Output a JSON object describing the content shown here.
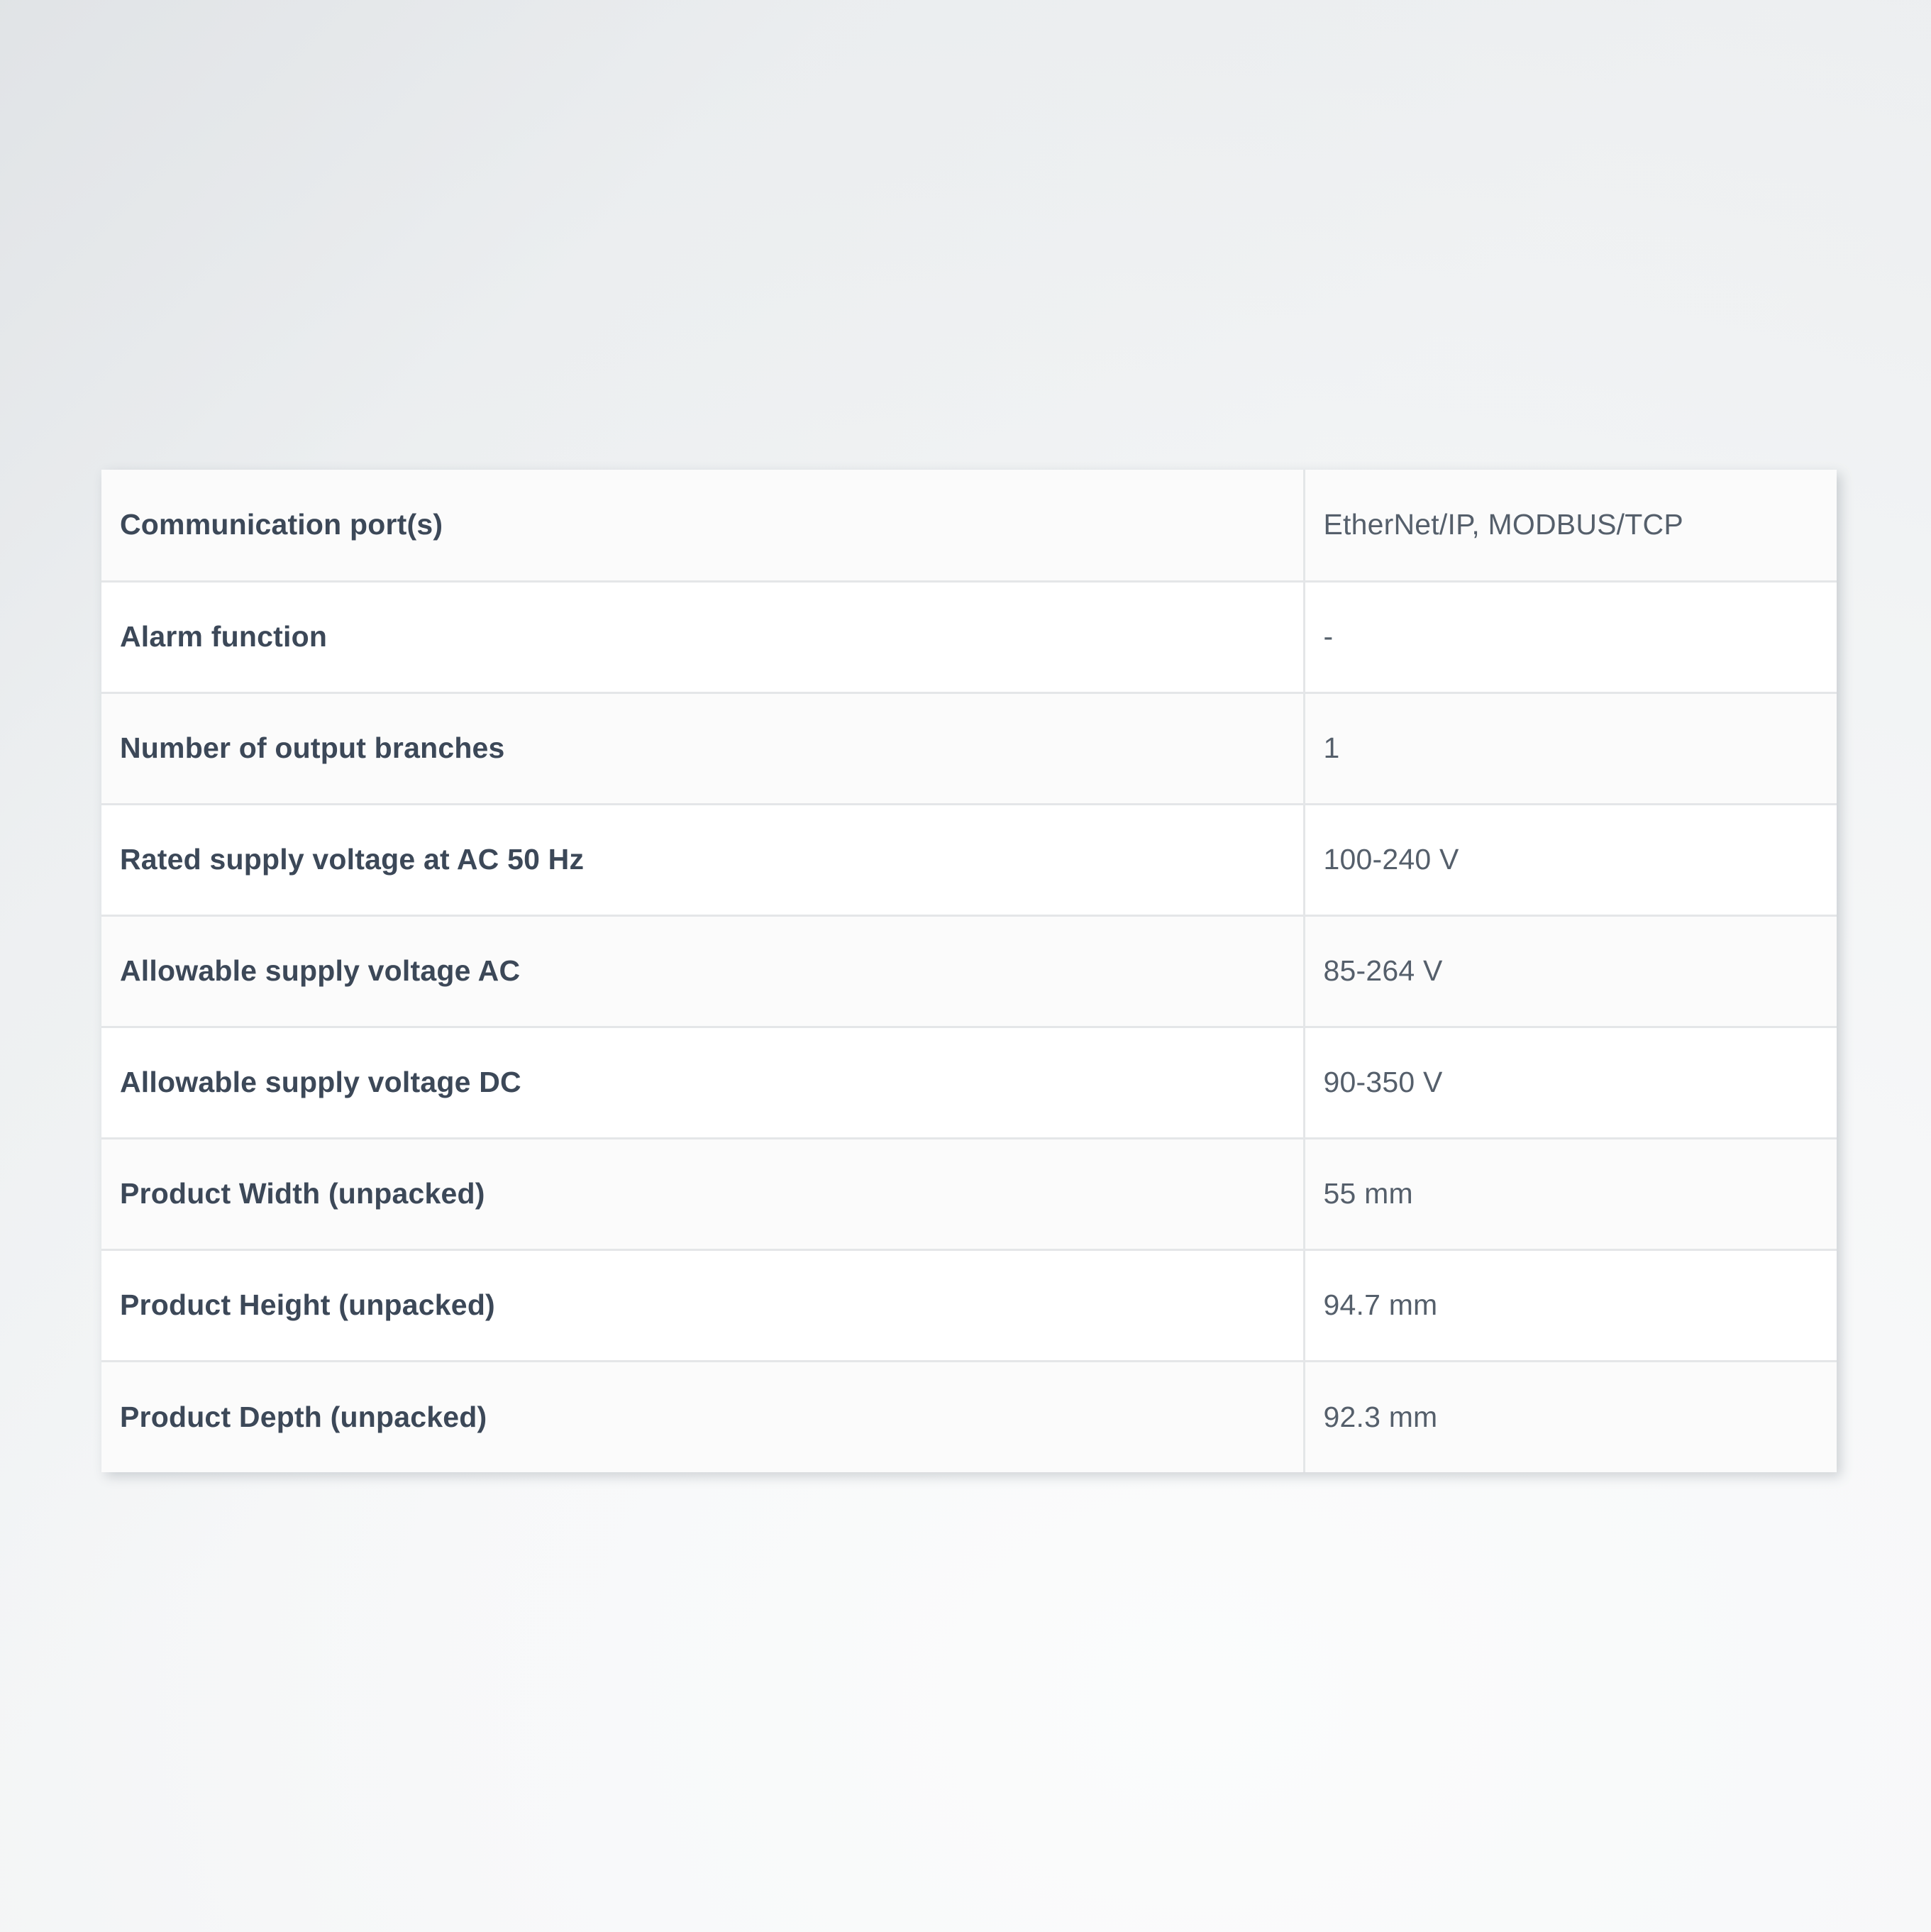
{
  "table": {
    "rows": [
      {
        "label": "Communication port(s)",
        "value": "EtherNet/IP, MODBUS/TCP"
      },
      {
        "label": "Alarm function",
        "value": "-"
      },
      {
        "label": "Number of output branches",
        "value": "1"
      },
      {
        "label": "Rated supply voltage at AC 50 Hz",
        "value": "100-240 V"
      },
      {
        "label": "Allowable supply voltage AC",
        "value": "85-264 V"
      },
      {
        "label": "Allowable supply voltage DC",
        "value": "90-350 V"
      },
      {
        "label": "Product Width (unpacked)",
        "value": "55 mm"
      },
      {
        "label": "Product Height (unpacked)",
        "value": "94.7 mm"
      },
      {
        "label": "Product Depth (unpacked)",
        "value": "92.3 mm"
      }
    ]
  },
  "colors": {
    "label_text": "#3c4858",
    "value_text": "#555f6b",
    "row_border": "#e4e6e8",
    "row_stripe": "#fbfbfb",
    "row_base": "#ffffff",
    "page_bg_light": "#fbfcfc",
    "page_bg_dark": "#e0e3e6"
  }
}
